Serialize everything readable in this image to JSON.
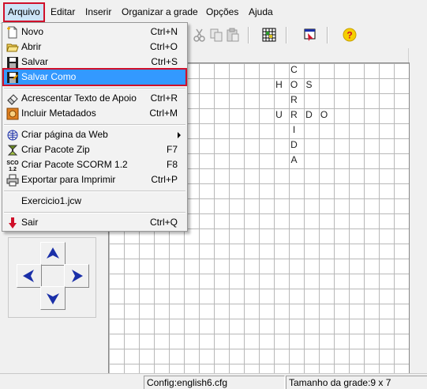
{
  "menubar": {
    "items": [
      {
        "label": "Arquivo"
      },
      {
        "label": "Editar"
      },
      {
        "label": "Inserir"
      },
      {
        "label": "Organizar a grade"
      },
      {
        "label": "Opções"
      },
      {
        "label": "Ajuda"
      }
    ]
  },
  "file_menu": {
    "items": [
      {
        "label": "Novo",
        "shortcut": "Ctrl+N",
        "icon": "new-file-icon"
      },
      {
        "label": "Abrir",
        "shortcut": "Ctrl+O",
        "icon": "open-folder-icon"
      },
      {
        "label": "Salvar",
        "shortcut": "Ctrl+S",
        "icon": "floppy-disk-icon"
      },
      {
        "label": "Salvar Como",
        "shortcut": "",
        "icon": "save-as-icon"
      },
      {
        "label": "Acrescentar Texto de Apoio",
        "shortcut": "Ctrl+R",
        "icon": "eraser-icon"
      },
      {
        "label": "Incluir Metadados",
        "shortcut": "Ctrl+M",
        "icon": "metadata-icon"
      },
      {
        "label": "Criar página da Web",
        "shortcut": "",
        "icon": "web-page-icon"
      },
      {
        "label": "Criar Pacote Zip",
        "shortcut": "F7",
        "icon": "zip-icon"
      },
      {
        "label": "Criar Pacote SCORM 1.2",
        "shortcut": "F8",
        "icon": "scorm-icon"
      },
      {
        "label": "Exportar para Imprimir",
        "shortcut": "Ctrl+P",
        "icon": "printer-icon"
      },
      {
        "label": "Exercicio1.jcw",
        "shortcut": "",
        "icon": ""
      },
      {
        "label": "Sair",
        "shortcut": "Ctrl+Q",
        "icon": "exit-arrow-icon"
      }
    ]
  },
  "grid": {
    "letters": [
      {
        "ch": "C",
        "col": 6,
        "row": 0
      },
      {
        "ch": "H",
        "col": 5,
        "row": 1
      },
      {
        "ch": "O",
        "col": 6,
        "row": 1
      },
      {
        "ch": "S",
        "col": 7,
        "row": 1
      },
      {
        "ch": "R",
        "col": 6,
        "row": 2
      },
      {
        "ch": "U",
        "col": 5,
        "row": 3
      },
      {
        "ch": "R",
        "col": 6,
        "row": 3
      },
      {
        "ch": "D",
        "col": 7,
        "row": 3
      },
      {
        "ch": "O",
        "col": 8,
        "row": 3
      },
      {
        "ch": "I",
        "col": 6,
        "row": 4
      },
      {
        "ch": "D",
        "col": 6,
        "row": 5
      },
      {
        "ch": "A",
        "col": 6,
        "row": 6
      }
    ]
  },
  "scorm_icon_text": "SCO\n1.2",
  "status": {
    "config": "Config:english6.cfg",
    "grid_size": "Tamanho da grade:9 x 7"
  },
  "colors": {
    "highlight": "#3399ff",
    "annotation_red": "#d0102a",
    "arrow_blue": "#1a2fa8"
  }
}
